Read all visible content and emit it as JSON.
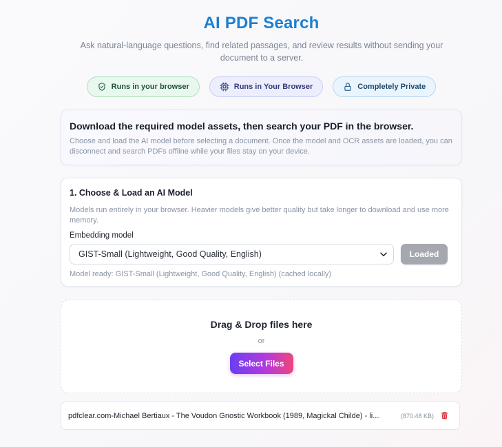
{
  "header": {
    "title": "AI PDF Search",
    "subtitle": "Ask natural-language questions, find related passages, and review results without sending your document to a server."
  },
  "badges": [
    {
      "label": "Runs in your browser",
      "icon": "shield-check-icon",
      "color": "#1f5136"
    },
    {
      "label": "Runs in Your Browser",
      "icon": "cpu-chip-icon",
      "color": "#333a7a"
    },
    {
      "label": "Completely Private",
      "icon": "lock-icon",
      "color": "#1e4a70"
    }
  ],
  "info_card": {
    "heading": "Download the required model assets, then search your PDF in the browser.",
    "body": "Choose and load the AI model before selecting a document. Once the model and OCR assets are loaded, you can disconnect and search PDFs offline while your files stay on your device."
  },
  "model_card": {
    "heading": "1. Choose & Load an AI Model",
    "description": "Models run entirely in your browser. Heavier models give better quality but take longer to download and use more memory.",
    "field_label": "Embedding model",
    "selected_model": "GIST-Small (Lightweight, Good Quality, English)",
    "load_button_label": "Loaded",
    "status": "Model ready: GIST-Small (Lightweight, Good Quality, English) (cached locally)"
  },
  "dropzone": {
    "title": "Drag & Drop files here",
    "or_text": "or",
    "button_label": "Select Files"
  },
  "files": [
    {
      "name": "pdfclear.com-Michael Bertiaux - The Voudon Gnostic Workbook (1989, Magickal Childe) - li...",
      "size": "(870.48 KB)"
    }
  ],
  "colors": {
    "title": "#1d7fcf",
    "delete_icon": "#e0303a",
    "button_gradient_start": "#6a3ff0",
    "button_gradient_end": "#f0457a",
    "loaded_button": "#a5a8ae"
  }
}
